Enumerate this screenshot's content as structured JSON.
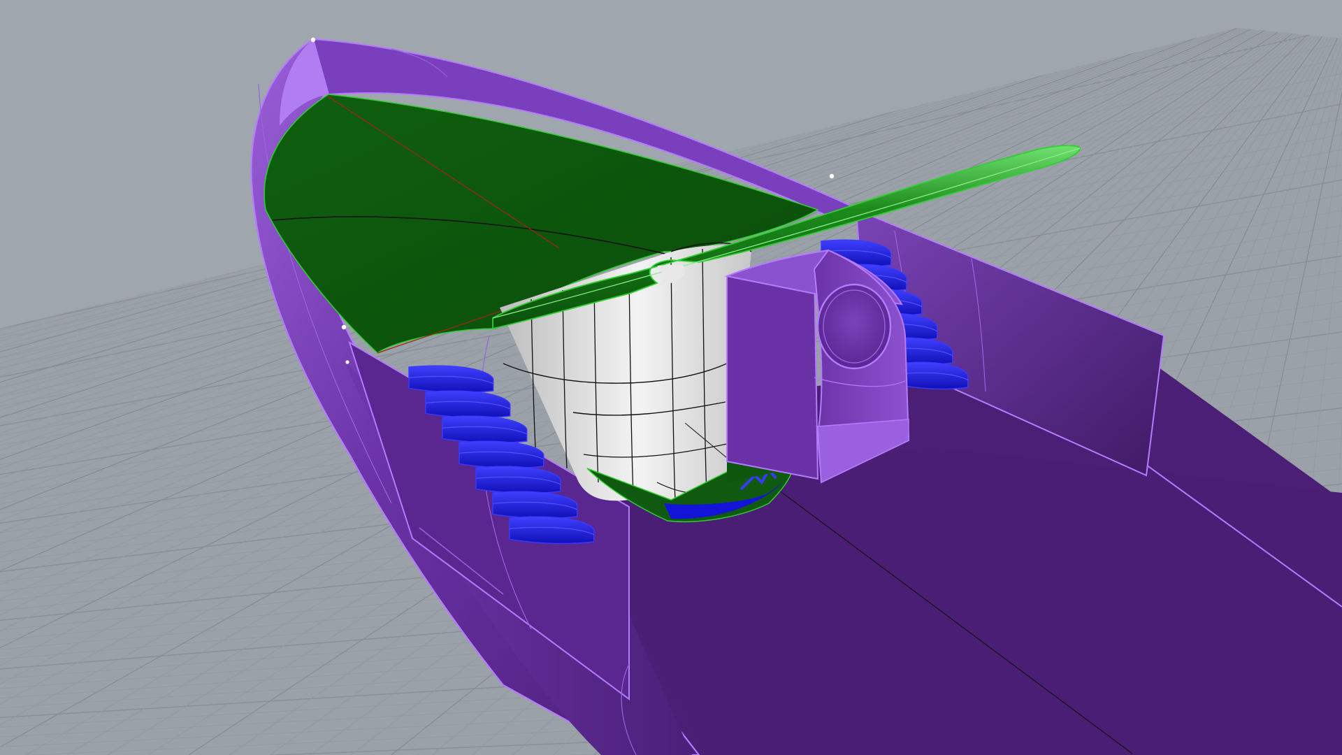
{
  "viewport": {
    "kind": "perspective-3d-modeling-viewport",
    "shading": "shaded",
    "grid": true,
    "background_color": "#a0a6ad",
    "colors": {
      "grid_minor": "#9399a1",
      "grid_major": "#878d95",
      "hull": "#6c33a8",
      "hull_light": "#a068dc",
      "hull_edge": "#b57bff",
      "deck": "#481c72",
      "foredeck": "#0d5b0d",
      "foredeck_edge": "#2fcf2f",
      "stairs": "#1414d9",
      "stairs_light": "#3a3aff",
      "shaft": "#e4e4e4",
      "isocurve": "#111111",
      "axis_x": "#a82020",
      "control_point": "#ffffff"
    }
  },
  "model": {
    "objects": [
      {
        "name": "hull",
        "color_key": "hull"
      },
      {
        "name": "aft-deck",
        "color_key": "deck"
      },
      {
        "name": "foredeck",
        "color_key": "foredeck"
      },
      {
        "name": "cross-beam",
        "color_key": "foredeck"
      },
      {
        "name": "port-stairs",
        "color_key": "stairs"
      },
      {
        "name": "starboard-stairs",
        "color_key": "stairs"
      },
      {
        "name": "central-shaft",
        "color_key": "shaft"
      },
      {
        "name": "console",
        "color_key": "hull"
      }
    ]
  }
}
